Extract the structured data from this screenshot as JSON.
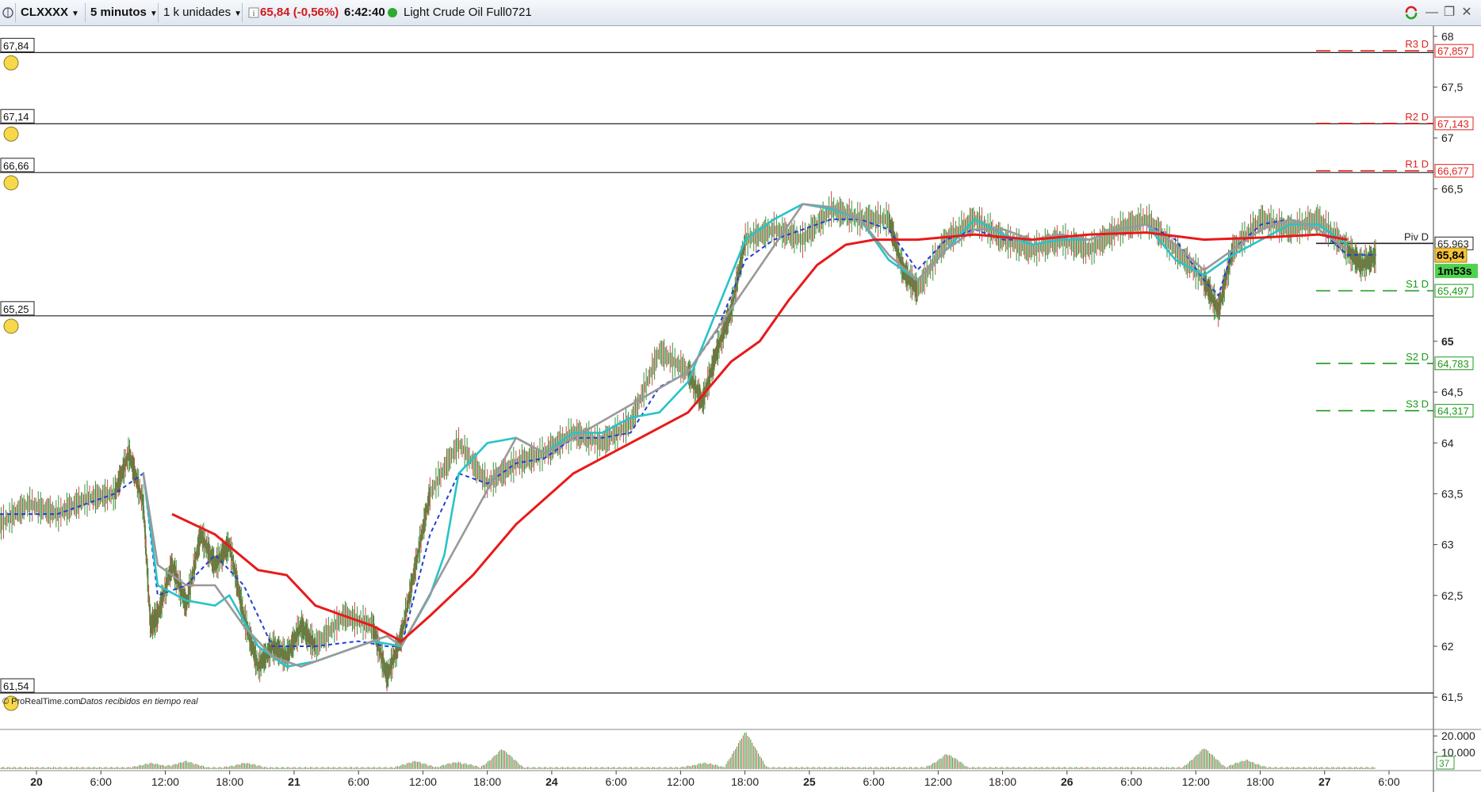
{
  "toolbar": {
    "symbol": "CLXXXX",
    "timeframe": "5 minutos",
    "units": "1 k unidades",
    "info_icon": "info-icon",
    "price": "65,84 (-0,56%)",
    "time": "6:42:40",
    "status_color": "#2eaa2e",
    "instrument": "Light Crude Oil Full0721",
    "window_controls": [
      "minimize-icon",
      "restore-icon",
      "close-icon"
    ]
  },
  "footer": {
    "brand": "© ProRealTime.com",
    "note": "Datos recibidos en tiempo real"
  },
  "chart_data": {
    "type": "line",
    "title": "",
    "x_tick_labels": [
      "20",
      "6:00",
      "12:00",
      "18:00",
      "21",
      "6:00",
      "12:00",
      "18:00",
      "24",
      "6:00",
      "12:00",
      "18:00",
      "25",
      "6:00",
      "12:00",
      "18:00",
      "26",
      "6:00",
      "12:00",
      "18:00",
      "27",
      "6:00"
    ],
    "x_tick_bold": [
      "20",
      "21",
      "24",
      "25",
      "26",
      "27"
    ],
    "y_range": [
      61.4,
      68.1
    ],
    "y_ticks": [
      {
        "value": 68,
        "label": "68"
      },
      {
        "value": 67.5,
        "label": "67,5"
      },
      {
        "value": 67,
        "label": "67"
      },
      {
        "value": 66.5,
        "label": "66,5"
      },
      {
        "value": 65,
        "label": "65"
      },
      {
        "value": 64.5,
        "label": "64,5"
      },
      {
        "value": 64,
        "label": "64"
      },
      {
        "value": 63.5,
        "label": "63,5"
      },
      {
        "value": 63,
        "label": "63"
      },
      {
        "value": 62.5,
        "label": "62,5"
      },
      {
        "value": 62,
        "label": "62"
      },
      {
        "value": 61.5,
        "label": "61,5"
      }
    ],
    "alert_lines": [
      {
        "value": 67.84,
        "label": "67,84"
      },
      {
        "value": 67.14,
        "label": "67,14"
      },
      {
        "value": 66.66,
        "label": "66,66"
      },
      {
        "value": 65.25,
        "label": "65,25"
      },
      {
        "value": 61.54,
        "label": "61,54"
      }
    ],
    "pivots": [
      {
        "name": "R3 D",
        "value": 67.857,
        "label": "67,857",
        "color": "#e0201e"
      },
      {
        "name": "R2 D",
        "value": 67.143,
        "label": "67,143",
        "color": "#e0201e"
      },
      {
        "name": "R1 D",
        "value": 66.677,
        "label": "66,677",
        "color": "#e0201e"
      },
      {
        "name": "Piv D",
        "value": 65.963,
        "label": "65,963",
        "color": "#222222"
      },
      {
        "name": "S1 D",
        "value": 65.497,
        "label": "65,497",
        "color": "#1a9a1a"
      },
      {
        "name": "S2 D",
        "value": 64.783,
        "label": "64,783",
        "color": "#1a9a1a"
      },
      {
        "name": "S3 D",
        "value": 64.317,
        "label": "64,317",
        "color": "#1a9a1a"
      }
    ],
    "current_price": {
      "value": 65.84,
      "label": "65,84",
      "countdown": "1m53s"
    },
    "series": [
      {
        "name": "price",
        "color": "#2f7d2f",
        "points": [
          [
            0,
            63.2
          ],
          [
            0.02,
            63.4
          ],
          [
            0.04,
            63.3
          ],
          [
            0.06,
            63.45
          ],
          [
            0.08,
            63.5
          ],
          [
            0.09,
            63.9
          ],
          [
            0.1,
            63.4
          ],
          [
            0.105,
            62.2
          ],
          [
            0.11,
            62.3
          ],
          [
            0.12,
            62.8
          ],
          [
            0.13,
            62.4
          ],
          [
            0.14,
            63.1
          ],
          [
            0.15,
            62.8
          ],
          [
            0.16,
            63.0
          ],
          [
            0.17,
            62.3
          ],
          [
            0.18,
            61.8
          ],
          [
            0.19,
            62.0
          ],
          [
            0.2,
            61.9
          ],
          [
            0.21,
            62.2
          ],
          [
            0.22,
            62.0
          ],
          [
            0.24,
            62.3
          ],
          [
            0.26,
            62.2
          ],
          [
            0.27,
            61.7
          ],
          [
            0.28,
            62.1
          ],
          [
            0.29,
            62.8
          ],
          [
            0.3,
            63.5
          ],
          [
            0.32,
            64.0
          ],
          [
            0.34,
            63.6
          ],
          [
            0.36,
            63.8
          ],
          [
            0.38,
            63.9
          ],
          [
            0.4,
            64.1
          ],
          [
            0.42,
            64.0
          ],
          [
            0.44,
            64.2
          ],
          [
            0.46,
            64.9
          ],
          [
            0.48,
            64.7
          ],
          [
            0.49,
            64.4
          ],
          [
            0.5,
            64.9
          ],
          [
            0.51,
            65.3
          ],
          [
            0.52,
            66.0
          ],
          [
            0.54,
            66.1
          ],
          [
            0.56,
            66.0
          ],
          [
            0.58,
            66.3
          ],
          [
            0.6,
            66.2
          ],
          [
            0.62,
            66.2
          ],
          [
            0.63,
            65.7
          ],
          [
            0.64,
            65.5
          ],
          [
            0.66,
            66.0
          ],
          [
            0.68,
            66.2
          ],
          [
            0.7,
            66.0
          ],
          [
            0.72,
            65.9
          ],
          [
            0.74,
            66.0
          ],
          [
            0.76,
            65.9
          ],
          [
            0.78,
            66.1
          ],
          [
            0.8,
            66.2
          ],
          [
            0.82,
            65.9
          ],
          [
            0.84,
            65.6
          ],
          [
            0.85,
            65.3
          ],
          [
            0.86,
            65.9
          ],
          [
            0.88,
            66.2
          ],
          [
            0.9,
            66.1
          ],
          [
            0.92,
            66.2
          ],
          [
            0.94,
            65.9
          ],
          [
            0.95,
            65.75
          ],
          [
            0.96,
            65.84
          ]
        ]
      },
      {
        "name": "ma_blue_dashed",
        "color": "#1f3fd6",
        "points": [
          [
            0,
            63.3
          ],
          [
            0.04,
            63.3
          ],
          [
            0.08,
            63.5
          ],
          [
            0.1,
            63.7
          ],
          [
            0.11,
            62.5
          ],
          [
            0.13,
            62.6
          ],
          [
            0.15,
            62.9
          ],
          [
            0.17,
            62.6
          ],
          [
            0.19,
            62.0
          ],
          [
            0.22,
            62.0
          ],
          [
            0.25,
            62.05
          ],
          [
            0.27,
            62.0
          ],
          [
            0.28,
            62.0
          ],
          [
            0.3,
            63.1
          ],
          [
            0.32,
            63.7
          ],
          [
            0.34,
            63.6
          ],
          [
            0.36,
            63.8
          ],
          [
            0.38,
            63.85
          ],
          [
            0.4,
            64.05
          ],
          [
            0.42,
            64.05
          ],
          [
            0.44,
            64.1
          ],
          [
            0.46,
            64.55
          ],
          [
            0.48,
            64.7
          ],
          [
            0.5,
            65.1
          ],
          [
            0.52,
            65.8
          ],
          [
            0.54,
            66.0
          ],
          [
            0.56,
            66.1
          ],
          [
            0.58,
            66.2
          ],
          [
            0.6,
            66.2
          ],
          [
            0.62,
            66.1
          ],
          [
            0.64,
            65.7
          ],
          [
            0.66,
            66.0
          ],
          [
            0.68,
            66.1
          ],
          [
            0.7,
            66.0
          ],
          [
            0.72,
            66.0
          ],
          [
            0.74,
            66.05
          ],
          [
            0.76,
            66.0
          ],
          [
            0.78,
            66.1
          ],
          [
            0.8,
            66.15
          ],
          [
            0.82,
            66.0
          ],
          [
            0.84,
            65.6
          ],
          [
            0.85,
            65.45
          ],
          [
            0.86,
            65.9
          ],
          [
            0.88,
            66.15
          ],
          [
            0.9,
            66.2
          ],
          [
            0.92,
            66.1
          ],
          [
            0.94,
            65.85
          ],
          [
            0.96,
            65.85
          ]
        ]
      },
      {
        "name": "ma_cyan",
        "color": "#28c3c8",
        "points": [
          [
            0.1,
            63.7
          ],
          [
            0.11,
            62.6
          ],
          [
            0.13,
            62.45
          ],
          [
            0.15,
            62.4
          ],
          [
            0.16,
            62.5
          ],
          [
            0.18,
            62.0
          ],
          [
            0.2,
            61.8
          ],
          [
            0.22,
            61.85
          ],
          [
            0.24,
            61.95
          ],
          [
            0.26,
            62.05
          ],
          [
            0.28,
            62.0
          ],
          [
            0.3,
            62.5
          ],
          [
            0.31,
            62.9
          ],
          [
            0.32,
            63.7
          ],
          [
            0.34,
            64.0
          ],
          [
            0.36,
            64.05
          ],
          [
            0.38,
            63.9
          ],
          [
            0.4,
            64.1
          ],
          [
            0.42,
            64.1
          ],
          [
            0.44,
            64.25
          ],
          [
            0.46,
            64.3
          ],
          [
            0.48,
            64.6
          ],
          [
            0.5,
            65.3
          ],
          [
            0.52,
            66.0
          ],
          [
            0.54,
            66.2
          ],
          [
            0.56,
            66.35
          ],
          [
            0.58,
            66.3
          ],
          [
            0.6,
            66.2
          ],
          [
            0.62,
            65.8
          ],
          [
            0.64,
            65.6
          ],
          [
            0.66,
            65.9
          ],
          [
            0.68,
            66.2
          ],
          [
            0.7,
            66.05
          ],
          [
            0.72,
            65.95
          ],
          [
            0.74,
            66.0
          ],
          [
            0.76,
            66.0
          ],
          [
            0.78,
            66.1
          ],
          [
            0.8,
            66.15
          ],
          [
            0.82,
            65.8
          ],
          [
            0.84,
            65.65
          ],
          [
            0.86,
            65.85
          ],
          [
            0.88,
            66.0
          ],
          [
            0.9,
            66.15
          ],
          [
            0.92,
            66.15
          ],
          [
            0.94,
            65.95
          ]
        ]
      },
      {
        "name": "ma_gray",
        "color": "#999999",
        "points": [
          [
            0.1,
            63.7
          ],
          [
            0.11,
            62.8
          ],
          [
            0.13,
            62.6
          ],
          [
            0.15,
            62.6
          ],
          [
            0.17,
            62.2
          ],
          [
            0.19,
            61.9
          ],
          [
            0.21,
            61.8
          ],
          [
            0.23,
            61.9
          ],
          [
            0.25,
            62.0
          ],
          [
            0.27,
            62.1
          ],
          [
            0.28,
            62.0
          ],
          [
            0.36,
            64.05
          ],
          [
            0.38,
            63.9
          ],
          [
            0.4,
            64.05
          ],
          [
            0.48,
            64.7
          ],
          [
            0.56,
            66.35
          ],
          [
            0.58,
            66.32
          ],
          [
            0.6,
            66.2
          ],
          [
            0.62,
            65.85
          ],
          [
            0.64,
            65.6
          ],
          [
            0.66,
            65.9
          ],
          [
            0.68,
            66.1
          ],
          [
            0.7,
            66.1
          ],
          [
            0.72,
            66.0
          ],
          [
            0.74,
            66.05
          ],
          [
            0.76,
            66.0
          ],
          [
            0.78,
            66.1
          ],
          [
            0.8,
            66.15
          ],
          [
            0.82,
            65.95
          ],
          [
            0.84,
            65.7
          ],
          [
            0.86,
            65.9
          ],
          [
            0.88,
            66.1
          ],
          [
            0.9,
            66.2
          ],
          [
            0.92,
            66.1
          ],
          [
            0.94,
            65.9
          ]
        ]
      },
      {
        "name": "ma_red",
        "color": "#e81a1a",
        "points": [
          [
            0.12,
            63.3
          ],
          [
            0.15,
            63.1
          ],
          [
            0.18,
            62.75
          ],
          [
            0.2,
            62.7
          ],
          [
            0.22,
            62.4
          ],
          [
            0.24,
            62.3
          ],
          [
            0.26,
            62.2
          ],
          [
            0.28,
            62.05
          ],
          [
            0.3,
            62.3
          ],
          [
            0.33,
            62.7
          ],
          [
            0.36,
            63.2
          ],
          [
            0.4,
            63.7
          ],
          [
            0.44,
            64.0
          ],
          [
            0.48,
            64.3
          ],
          [
            0.51,
            64.8
          ],
          [
            0.53,
            65.0
          ],
          [
            0.55,
            65.4
          ],
          [
            0.57,
            65.75
          ],
          [
            0.59,
            65.95
          ],
          [
            0.61,
            66.0
          ],
          [
            0.64,
            66.0
          ],
          [
            0.68,
            66.05
          ],
          [
            0.72,
            66.0
          ],
          [
            0.76,
            66.05
          ],
          [
            0.8,
            66.07
          ],
          [
            0.84,
            66.0
          ],
          [
            0.88,
            66.02
          ],
          [
            0.92,
            66.05
          ],
          [
            0.94,
            66.0
          ]
        ]
      }
    ],
    "volume_axis": {
      "ticks": [
        {
          "value": 20000,
          "label": "20.000"
        },
        {
          "value": 10000,
          "label": "10.000"
        }
      ],
      "current": "37"
    },
    "volume_bursts": [
      {
        "x": 0.105,
        "v": 3000
      },
      {
        "x": 0.13,
        "v": 4000
      },
      {
        "x": 0.17,
        "v": 4500
      },
      {
        "x": 0.29,
        "v": 4000
      },
      {
        "x": 0.32,
        "v": 7000
      },
      {
        "x": 0.35,
        "v": 12000
      },
      {
        "x": 0.49,
        "v": 5000
      },
      {
        "x": 0.52,
        "v": 22000
      },
      {
        "x": 0.66,
        "v": 11000
      },
      {
        "x": 0.84,
        "v": 12000
      },
      {
        "x": 0.87,
        "v": 6000
      }
    ]
  }
}
